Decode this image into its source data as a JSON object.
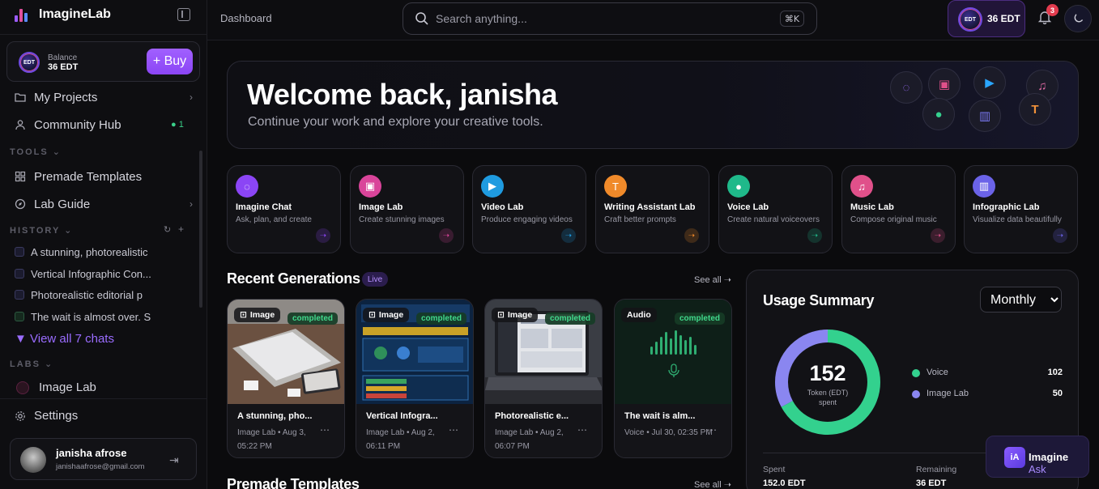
{
  "brand": {
    "title": "ImagineLab"
  },
  "balance": {
    "label": "Balance",
    "value": "36 EDT",
    "buy": "+ Buy",
    "badge": "EDT"
  },
  "nav": [
    {
      "label": "My Projects",
      "icon": "folder-icon"
    },
    {
      "label": "Community Hub",
      "icon": "users-icon",
      "online": "● 1"
    }
  ],
  "tools_label": "TOOLS ⌄",
  "tools": [
    {
      "label": "Premade Templates",
      "icon": "grid-icon"
    },
    {
      "label": "Lab Guide",
      "icon": "compass-icon"
    }
  ],
  "history_label": "HISTORY ⌄",
  "history": [
    {
      "label": "A stunning, photorealistic"
    },
    {
      "label": "Vertical Infographic Con..."
    },
    {
      "label": "Photorealistic editorial p"
    },
    {
      "label": "The wait is almost over. S"
    }
  ],
  "view_all": "▼ View all 7 chats",
  "labs_label": "LABS ⌄",
  "labs_item": "Image Lab",
  "settings": "Settings",
  "user": {
    "name": "janisha afrose",
    "email": "janishaafrose@gmail.com"
  },
  "topbar": {
    "breadcrumb": "Dashboard",
    "search_placeholder": "Search anything...",
    "shortcut": "⌘K",
    "tokens": "36 EDT",
    "notifications": "3"
  },
  "hero": {
    "title": "Welcome back, janisha",
    "subtitle": "Continue your work and explore your creative tools."
  },
  "lab_cards": [
    {
      "title": "Imagine Chat",
      "desc": "Ask, plan, and create",
      "color": "#8b45f5",
      "icon": "chat-icon"
    },
    {
      "title": "Image Lab",
      "desc": "Create stunning images",
      "color": "#d9449a",
      "icon": "image-icon"
    },
    {
      "title": "Video Lab",
      "desc": "Produce engaging videos",
      "color": "#1f9be0",
      "icon": "video-icon"
    },
    {
      "title": "Writing Assistant Lab",
      "desc": "Craft better prompts",
      "color": "#f08a2a",
      "icon": "text-icon"
    },
    {
      "title": "Voice Lab",
      "desc": "Create natural voiceovers",
      "color": "#1fb98a",
      "icon": "mic-icon"
    },
    {
      "title": "Music Lab",
      "desc": "Compose original music",
      "color": "#e0508a",
      "icon": "music-icon"
    },
    {
      "title": "Infographic Lab",
      "desc": "Visualize data beautifully",
      "color": "#6b63e8",
      "icon": "chart-icon"
    }
  ],
  "recent": {
    "title": "Recent Generations",
    "live": "Live",
    "see_all": "See all ➝",
    "items": [
      {
        "type": "Image",
        "status": "completed",
        "title": "A stunning, pho...",
        "meta": "Image Lab • Aug 3, 05:22 PM"
      },
      {
        "type": "Image",
        "status": "completed",
        "title": "Vertical Infogra...",
        "meta": "Image Lab • Aug 2, 06:11 PM"
      },
      {
        "type": "Image",
        "status": "completed",
        "title": "Photorealistic e...",
        "meta": "Image Lab • Aug 2, 06:07 PM"
      },
      {
        "type": "Audio",
        "status": "completed",
        "title": "The wait is alm...",
        "meta": "Voice • Jul 30, 02:35 PM"
      }
    ]
  },
  "templates": {
    "title": "Premade Templates",
    "see_all": "See all ➝"
  },
  "usage": {
    "title": "Usage Summary",
    "period": "Monthly",
    "total": "152",
    "total_label": "Token (EDT) spent",
    "legend": [
      {
        "name": "Voice",
        "value": "102",
        "color": "#33d18e"
      },
      {
        "name": "Image Lab",
        "value": "50",
        "color": "#8a86f0"
      }
    ],
    "spent_label": "Spent",
    "spent": "152.0 EDT",
    "remaining_label": "Remaining",
    "remaining": "36 EDT"
  },
  "ask": {
    "logo": "iA",
    "name": "Imagine",
    "suffix": "Ask"
  }
}
